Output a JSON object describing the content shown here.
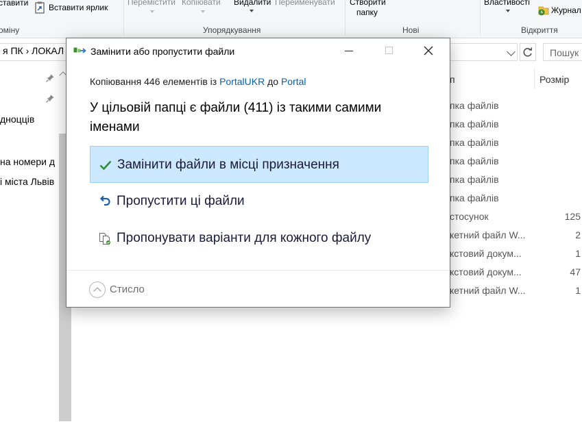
{
  "ribbon": {
    "paste_label": "ставити",
    "paste_shortcut_label": "Вставити ярлик",
    "clipboard_group": "оміну",
    "move_to_label": "Перемістити",
    "copy_to_label": "Копіювати",
    "delete_label": "Видалити",
    "rename_label": "Перейменувати",
    "organize_group": "Упорядкування",
    "new_folder_line1": "Створити",
    "new_folder_line2": "папку",
    "new_group": "Нові",
    "properties_label": "Властивості",
    "history_label": "Журнал",
    "open_group": "Відкриття"
  },
  "address": {
    "path_text": "я ПК  ›  ЛОКАЛ",
    "search_placeholder": "Пошук"
  },
  "nav": {
    "items": [
      "дноцців",
      "на номери д",
      "і міста Львів"
    ]
  },
  "file_list": {
    "size_header": "Розмір",
    "header_fragment": "п",
    "rows": [
      {
        "type": "пка файлів",
        "size": ""
      },
      {
        "type": "пка файлів",
        "size": ""
      },
      {
        "type": "пка файлів",
        "size": ""
      },
      {
        "type": "пка файлів",
        "size": ""
      },
      {
        "type": "пка файлів",
        "size": ""
      },
      {
        "type": "пка файлів",
        "size": ""
      },
      {
        "type": "стосунок",
        "size": "125"
      },
      {
        "type": "кетний файл W...",
        "size": "2"
      },
      {
        "type": "кстовий докум...",
        "size": "1"
      },
      {
        "type": "кстовий докум...",
        "size": "47"
      },
      {
        "type": "кетний файл W...",
        "size": "1"
      }
    ]
  },
  "dialog": {
    "title": "Замінити або пропустити файли",
    "copy_prefix": "Копіювання 446 елементів із ",
    "source_folder": "PortalUKR",
    "copy_mid": " до ",
    "dest_folder": "Portal",
    "headline": "У цільовій папці є файли (411) із такими самими іменами",
    "options": {
      "replace": "Замінити файли в місці призначення",
      "skip": "Пропустити ці файли",
      "decide": "Пропонувати варіанти для кожного файлу"
    },
    "details_label": "Стисло"
  },
  "colors": {
    "accent_link": "#0063b1",
    "selected_bg": "#cce8ff",
    "selected_border": "#99d1ff",
    "check_green": "#2e8b3a"
  }
}
